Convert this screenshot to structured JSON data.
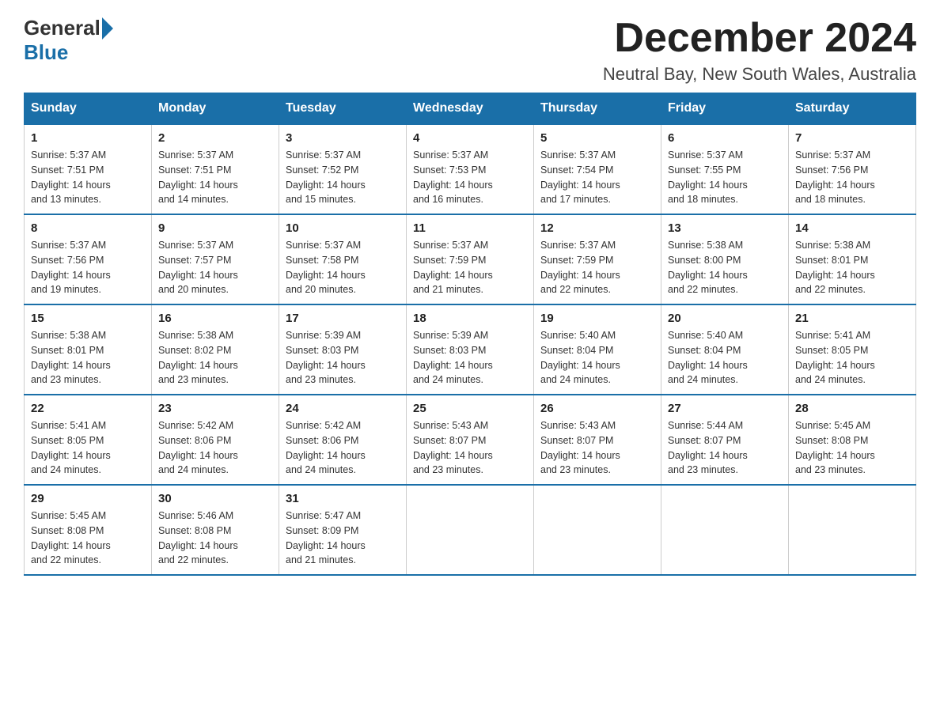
{
  "logo": {
    "general": "General",
    "blue": "Blue"
  },
  "header": {
    "month_year": "December 2024",
    "location": "Neutral Bay, New South Wales, Australia"
  },
  "days_of_week": [
    "Sunday",
    "Monday",
    "Tuesday",
    "Wednesday",
    "Thursday",
    "Friday",
    "Saturday"
  ],
  "weeks": [
    [
      {
        "day": "1",
        "sunrise": "5:37 AM",
        "sunset": "7:51 PM",
        "daylight": "14 hours and 13 minutes."
      },
      {
        "day": "2",
        "sunrise": "5:37 AM",
        "sunset": "7:51 PM",
        "daylight": "14 hours and 14 minutes."
      },
      {
        "day": "3",
        "sunrise": "5:37 AM",
        "sunset": "7:52 PM",
        "daylight": "14 hours and 15 minutes."
      },
      {
        "day": "4",
        "sunrise": "5:37 AM",
        "sunset": "7:53 PM",
        "daylight": "14 hours and 16 minutes."
      },
      {
        "day": "5",
        "sunrise": "5:37 AM",
        "sunset": "7:54 PM",
        "daylight": "14 hours and 17 minutes."
      },
      {
        "day": "6",
        "sunrise": "5:37 AM",
        "sunset": "7:55 PM",
        "daylight": "14 hours and 18 minutes."
      },
      {
        "day": "7",
        "sunrise": "5:37 AM",
        "sunset": "7:56 PM",
        "daylight": "14 hours and 18 minutes."
      }
    ],
    [
      {
        "day": "8",
        "sunrise": "5:37 AM",
        "sunset": "7:56 PM",
        "daylight": "14 hours and 19 minutes."
      },
      {
        "day": "9",
        "sunrise": "5:37 AM",
        "sunset": "7:57 PM",
        "daylight": "14 hours and 20 minutes."
      },
      {
        "day": "10",
        "sunrise": "5:37 AM",
        "sunset": "7:58 PM",
        "daylight": "14 hours and 20 minutes."
      },
      {
        "day": "11",
        "sunrise": "5:37 AM",
        "sunset": "7:59 PM",
        "daylight": "14 hours and 21 minutes."
      },
      {
        "day": "12",
        "sunrise": "5:37 AM",
        "sunset": "7:59 PM",
        "daylight": "14 hours and 22 minutes."
      },
      {
        "day": "13",
        "sunrise": "5:38 AM",
        "sunset": "8:00 PM",
        "daylight": "14 hours and 22 minutes."
      },
      {
        "day": "14",
        "sunrise": "5:38 AM",
        "sunset": "8:01 PM",
        "daylight": "14 hours and 22 minutes."
      }
    ],
    [
      {
        "day": "15",
        "sunrise": "5:38 AM",
        "sunset": "8:01 PM",
        "daylight": "14 hours and 23 minutes."
      },
      {
        "day": "16",
        "sunrise": "5:38 AM",
        "sunset": "8:02 PM",
        "daylight": "14 hours and 23 minutes."
      },
      {
        "day": "17",
        "sunrise": "5:39 AM",
        "sunset": "8:03 PM",
        "daylight": "14 hours and 23 minutes."
      },
      {
        "day": "18",
        "sunrise": "5:39 AM",
        "sunset": "8:03 PM",
        "daylight": "14 hours and 24 minutes."
      },
      {
        "day": "19",
        "sunrise": "5:40 AM",
        "sunset": "8:04 PM",
        "daylight": "14 hours and 24 minutes."
      },
      {
        "day": "20",
        "sunrise": "5:40 AM",
        "sunset": "8:04 PM",
        "daylight": "14 hours and 24 minutes."
      },
      {
        "day": "21",
        "sunrise": "5:41 AM",
        "sunset": "8:05 PM",
        "daylight": "14 hours and 24 minutes."
      }
    ],
    [
      {
        "day": "22",
        "sunrise": "5:41 AM",
        "sunset": "8:05 PM",
        "daylight": "14 hours and 24 minutes."
      },
      {
        "day": "23",
        "sunrise": "5:42 AM",
        "sunset": "8:06 PM",
        "daylight": "14 hours and 24 minutes."
      },
      {
        "day": "24",
        "sunrise": "5:42 AM",
        "sunset": "8:06 PM",
        "daylight": "14 hours and 24 minutes."
      },
      {
        "day": "25",
        "sunrise": "5:43 AM",
        "sunset": "8:07 PM",
        "daylight": "14 hours and 23 minutes."
      },
      {
        "day": "26",
        "sunrise": "5:43 AM",
        "sunset": "8:07 PM",
        "daylight": "14 hours and 23 minutes."
      },
      {
        "day": "27",
        "sunrise": "5:44 AM",
        "sunset": "8:07 PM",
        "daylight": "14 hours and 23 minutes."
      },
      {
        "day": "28",
        "sunrise": "5:45 AM",
        "sunset": "8:08 PM",
        "daylight": "14 hours and 23 minutes."
      }
    ],
    [
      {
        "day": "29",
        "sunrise": "5:45 AM",
        "sunset": "8:08 PM",
        "daylight": "14 hours and 22 minutes."
      },
      {
        "day": "30",
        "sunrise": "5:46 AM",
        "sunset": "8:08 PM",
        "daylight": "14 hours and 22 minutes."
      },
      {
        "day": "31",
        "sunrise": "5:47 AM",
        "sunset": "8:09 PM",
        "daylight": "14 hours and 21 minutes."
      },
      null,
      null,
      null,
      null
    ]
  ],
  "labels": {
    "sunrise": "Sunrise:",
    "sunset": "Sunset:",
    "daylight": "Daylight:"
  }
}
